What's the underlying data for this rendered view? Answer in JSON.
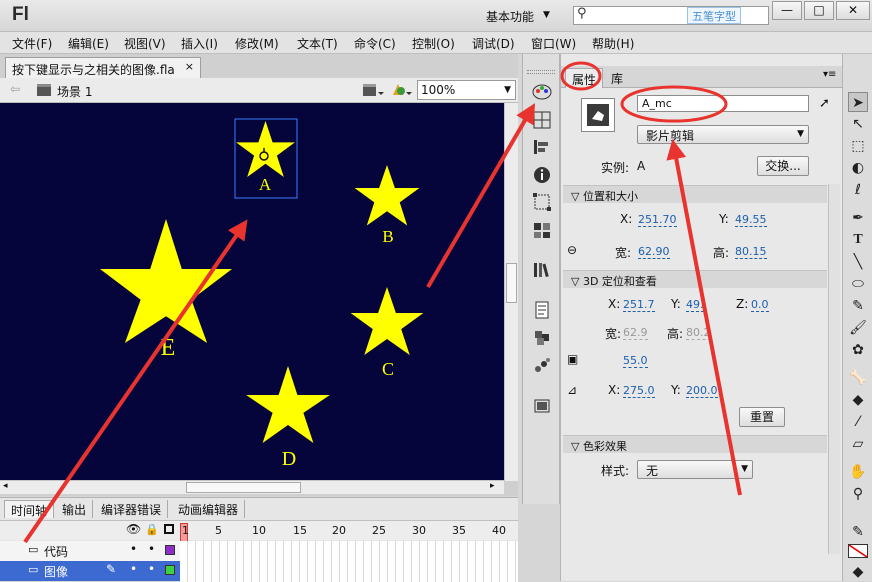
{
  "app": {
    "logo": "Fl",
    "workspace": "基本功能",
    "watermark": "五笔字型"
  },
  "window_buttons": [
    "—",
    "□",
    "✕"
  ],
  "menu": [
    "文件(F)",
    "编辑(E)",
    "视图(V)",
    "插入(I)",
    "修改(M)",
    "文本(T)",
    "命令(C)",
    "控制(O)",
    "调试(D)",
    "窗口(W)",
    "帮助(H)"
  ],
  "document": {
    "tab_title": "按下键显示与之相关的图像.fla",
    "close": "×"
  },
  "editbar": {
    "scene": "场景 1",
    "zoom": "100%"
  },
  "stage": {
    "background": "#05053c",
    "star_color": "#ffff00",
    "stars": [
      {
        "label": "A",
        "selected": true
      },
      {
        "label": "B"
      },
      {
        "label": "C"
      },
      {
        "label": "D"
      },
      {
        "label": "E"
      }
    ]
  },
  "timeline": {
    "tabs": [
      "时间轴",
      "输出",
      "编译器错误",
      "动画编辑器"
    ],
    "frame_numbers": [
      "1",
      "5",
      "10",
      "15",
      "20",
      "25",
      "30",
      "35",
      "40"
    ],
    "layers": [
      {
        "name": "代码",
        "selected": false,
        "color": "#8b2fc7"
      },
      {
        "name": "图像",
        "selected": true,
        "color": "#3fcf3f"
      }
    ]
  },
  "properties": {
    "tabs": [
      "属性",
      "库"
    ],
    "instance_name": "A_mc",
    "symbol_type": "影片剪辑",
    "instance_label": "实例:",
    "instance_of": "A",
    "swap_button": "交换...",
    "section_position": "位置和大小",
    "x_label": "X:",
    "x_value": "251.70",
    "y_label": "Y:",
    "y_value": "49.55",
    "w_label": "宽:",
    "w_value": "62.90",
    "h_label": "高:",
    "h_value": "80.15",
    "section_3d": "3D 定位和查看",
    "x3d": "251.7",
    "y3d": "49.",
    "z_label": "Z:",
    "z3d": "0.0",
    "w3d": "62.9",
    "h3d": "80.2",
    "perspective": "55.0",
    "vp_x": "275.0",
    "vp_y_label": "Y:",
    "vp_y": "200.0",
    "reset_button": "重置",
    "section_color": "色彩效果",
    "style_label": "样式:",
    "style_value": "无"
  },
  "annotations": {
    "arrow_color": "#e8332e"
  }
}
